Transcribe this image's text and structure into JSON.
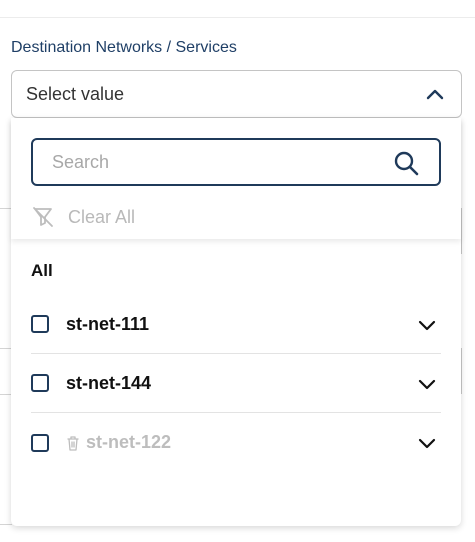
{
  "field": {
    "label": "Destination Networks / Services",
    "select_value": "Select value",
    "expanded": true
  },
  "dropdown": {
    "search_placeholder": "Search",
    "clear_all_label": "Clear All",
    "all_label": "All",
    "options": [
      {
        "label": "st-net-111",
        "checked": false,
        "disabled": false,
        "deleted": false
      },
      {
        "label": "st-net-144",
        "checked": false,
        "disabled": false,
        "deleted": false
      },
      {
        "label": "st-net-122",
        "checked": false,
        "disabled": true,
        "deleted": true
      }
    ]
  },
  "icons": {
    "select_toggle": "chevron-up-icon",
    "search": "search-icon",
    "clear_all": "filter-off-icon",
    "option_expand": "chevron-down-icon",
    "deleted": "trash-icon"
  },
  "colors": {
    "label": "#1f3f66",
    "accent_border": "#1f3a5a",
    "disabled_text": "#bdbdbd"
  }
}
